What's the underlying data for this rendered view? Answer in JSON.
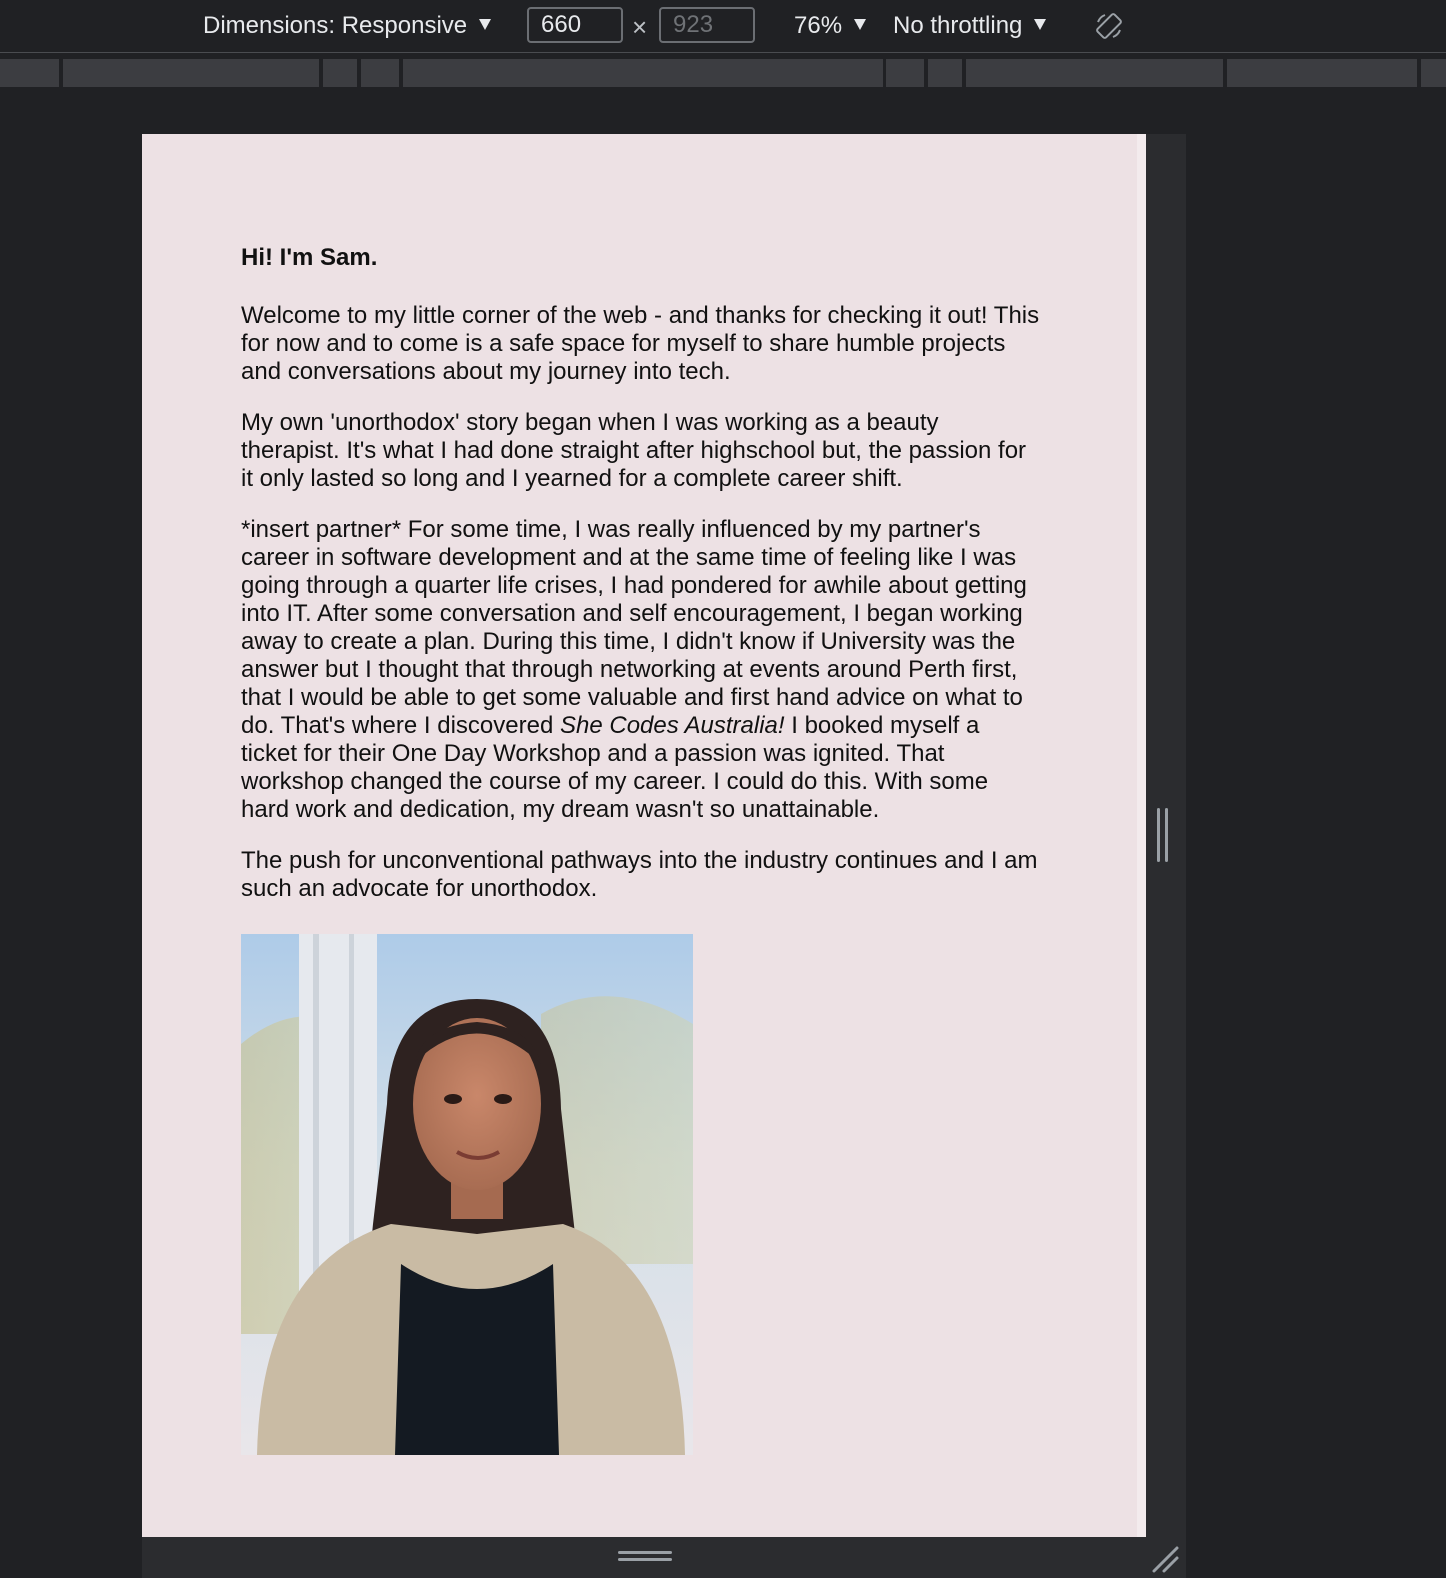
{
  "toolbar": {
    "dimensions_label": "Dimensions: Responsive",
    "width_value": "660",
    "height_placeholder": "923",
    "times_symbol": "×",
    "zoom_label": "76%",
    "throttling_label": "No throttling",
    "rotate_icon": "rotate-icon"
  },
  "page": {
    "heading": "Hi! I'm Sam.",
    "paragraphs": [
      "Welcome to my little corner of the web - and thanks for checking it out! This for now and to come is a safe space for myself to share humble projects and conversations about my journey into tech.",
      "My own 'unorthodox' story began when I was working as a beauty therapist. It's what I had done straight after highschool but, the passion for it only lasted so long and I yearned for a complete career shift."
    ],
    "story": {
      "before": "*insert partner* For some time, I was really influenced by my partner's career in software development and at the same time of feeling like I was going through a quarter life crises, I had pondered for awhile about getting into IT. After some conversation and self encouragement, I began working away to create a plan. During this time, I didn't know if University was the answer but I thought that through networking at events around Perth first, that I would be able to get some valuable and first hand advice on what to do. That's where I discovered ",
      "emphasis": "She Codes Australia!",
      "after": " I booked myself a ticket for their One Day Workshop and a passion was ignited. That workshop changed the course of my career. I could do this. With some hard work and dedication, my dream wasn't so unattainable."
    },
    "closing": "The push for unconventional pathways into the industry continues and I am such an advocate for unorthodox.",
    "background_color": "#ede1e4"
  }
}
